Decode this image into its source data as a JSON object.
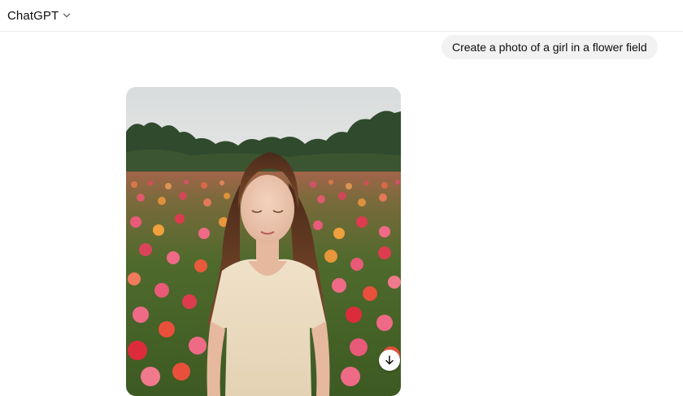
{
  "header": {
    "model_label": "ChatGPT",
    "model_menu_icon": "chevron-down-icon"
  },
  "conversation": {
    "user_message": "Create a photo of a girl in a flower field",
    "assistant_image": {
      "alt": "Create a photo of a girl in a flower field",
      "download_icon": "arrow-down-icon"
    }
  },
  "colors": {
    "bubble_bg": "#f2f2f2",
    "divider": "#ececec",
    "text": "#0d0d0d"
  }
}
